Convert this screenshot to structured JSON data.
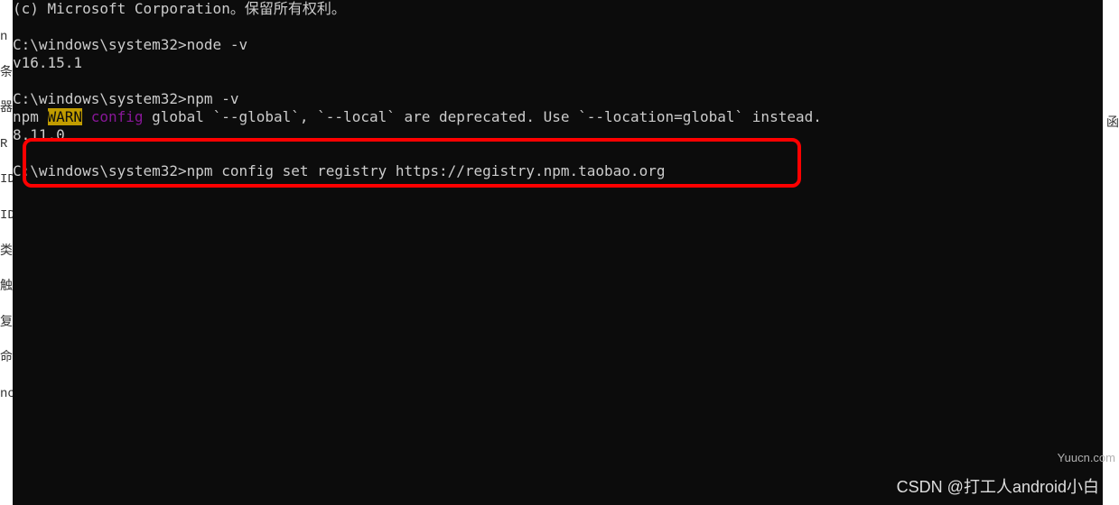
{
  "left_edge": {
    "chars": [
      "n",
      "条",
      "器",
      "R",
      "ID",
      "ID",
      "类",
      "触",
      "复",
      "",
      "命",
      "",
      "nc"
    ]
  },
  "terminal": {
    "line1": "(c) Microsoft Corporation。保留所有权利。",
    "prompt1": "C:\\windows\\system32>",
    "cmd1": "node -v",
    "out1": "v16.15.1",
    "prompt2": "C:\\windows\\system32>",
    "cmd2": "npm -v",
    "npm_prefix": "npm ",
    "warn_label": "WARN",
    "config_label": " config",
    "warn_msg": " global `--global`, `--local` are deprecated. Use `--location=global` instead.",
    "out2": "8.11.0",
    "prompt3": "C:\\windows\\system32>",
    "cmd3": "npm config set registry https://registry.npm.taobao.org"
  },
  "watermarks": {
    "bottom": "CSDN @打工人android小白",
    "right": "Yuucn.com",
    "right_char": "函"
  }
}
